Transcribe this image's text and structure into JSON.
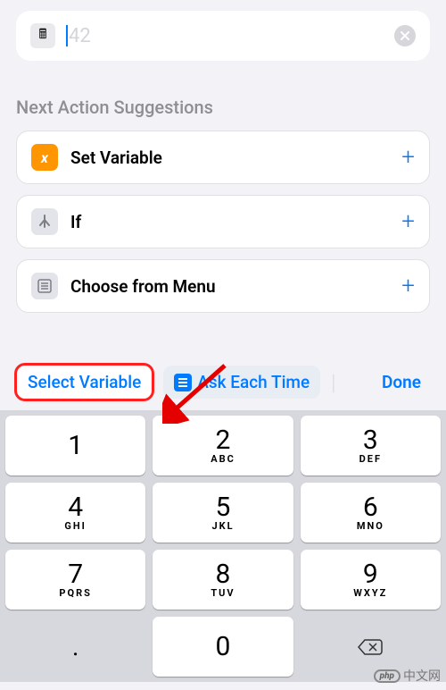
{
  "input": {
    "icon": "🖩",
    "value": "42"
  },
  "suggestions": {
    "title": "Next Action Suggestions",
    "items": [
      {
        "icon_label": "x",
        "icon_class": "orange",
        "label": "Set Variable"
      },
      {
        "icon_label": "⑂",
        "icon_class": "gray",
        "label": "If"
      },
      {
        "icon_label": "☰",
        "icon_class": "gray",
        "label": "Choose from Menu"
      }
    ]
  },
  "toolbar": {
    "select_variable": "Select Variable",
    "ask_each_time": "Ask Each Time",
    "done": "Done"
  },
  "keypad": [
    {
      "num": "1",
      "sub": ""
    },
    {
      "num": "2",
      "sub": "ABC"
    },
    {
      "num": "3",
      "sub": "DEF"
    },
    {
      "num": "4",
      "sub": "GHI"
    },
    {
      "num": "5",
      "sub": "JKL"
    },
    {
      "num": "6",
      "sub": "MNO"
    },
    {
      "num": "7",
      "sub": "PQRS"
    },
    {
      "num": "8",
      "sub": "TUV"
    },
    {
      "num": "9",
      "sub": "WXYZ"
    },
    {
      "num": ".",
      "sub": "",
      "special": true
    },
    {
      "num": "0",
      "sub": ""
    },
    {
      "num": "⌫",
      "sub": "",
      "special": true
    }
  ],
  "watermark": {
    "badge": "php",
    "text": "中文网"
  }
}
